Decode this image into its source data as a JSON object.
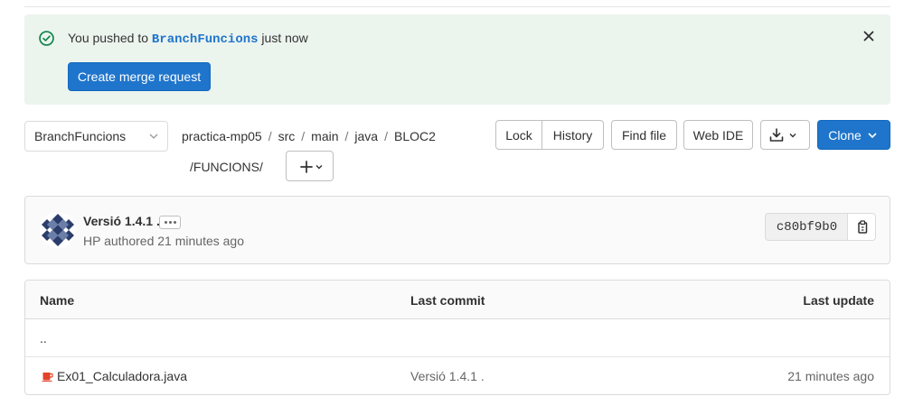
{
  "alert": {
    "prefix": "You pushed to",
    "branch": "BranchFuncions",
    "suffix": "just now",
    "button_label": "Create merge request",
    "icons": {
      "status": "check-circle-icon",
      "close": "close-icon"
    }
  },
  "branch_selector": {
    "value": "BranchFuncions"
  },
  "breadcrumb": {
    "items": [
      "practica-mp05",
      "src",
      "main",
      "java",
      "BLOC2",
      "FUNCIONS"
    ],
    "separator": "/"
  },
  "toolbar": {
    "lock": "Lock",
    "history": "History",
    "find_file": "Find file",
    "web_ide": "Web IDE",
    "clone": "Clone"
  },
  "commit": {
    "title": "Versió 1.4.1 .",
    "author": "HP",
    "authored_text": "authored",
    "time": "21 minutes ago",
    "sha": "c80bf9b0"
  },
  "table": {
    "headers": {
      "name": "Name",
      "last_commit": "Last commit",
      "last_update": "Last update"
    },
    "parent_dir": "..",
    "rows": [
      {
        "name": "Ex01_Calculadora.java",
        "last_commit": "Versió 1.4.1 .",
        "last_update": "21 minutes ago",
        "icon": "java-file-icon"
      }
    ]
  },
  "colors": {
    "primary": "#1f75cb",
    "success_bg": "#ecf4ee",
    "success_icon": "#108548",
    "java_icon": "#e24329"
  }
}
